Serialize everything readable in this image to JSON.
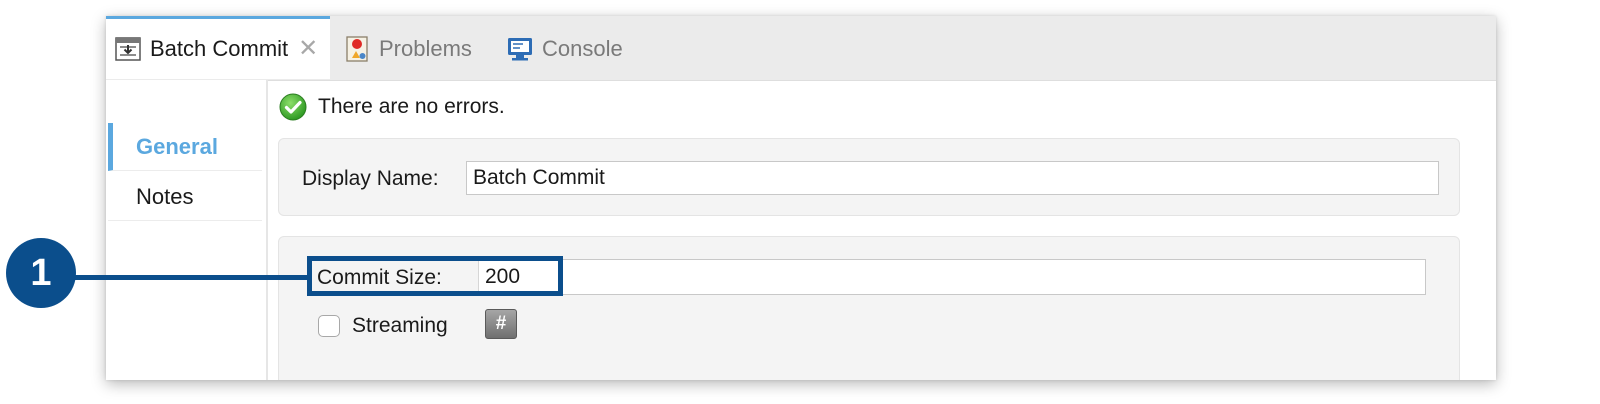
{
  "tabs": [
    {
      "label": "Batch Commit",
      "icon": "batch-commit-icon",
      "active": true,
      "close": "✕"
    },
    {
      "label": "Problems",
      "icon": "problems-icon",
      "active": false
    },
    {
      "label": "Console",
      "icon": "console-icon",
      "active": false
    }
  ],
  "sidebar": {
    "items": [
      {
        "label": "General",
        "active": true
      },
      {
        "label": "Notes",
        "active": false
      }
    ]
  },
  "status": {
    "icon": "check-circle-icon",
    "text": "There are no errors."
  },
  "general": {
    "display_name_label": "Display Name:",
    "display_name_value": "Batch Commit",
    "commit_size_label": "Commit Size:",
    "commit_size_value": "200",
    "streaming_label": "Streaming",
    "streaming_checked": false,
    "expression_button": "#"
  },
  "callout": {
    "number": "1",
    "color": "#0b4e8c"
  },
  "colors": {
    "accent": "#5ba8df",
    "callout": "#0b4e8c",
    "success": "#3faa2f"
  }
}
